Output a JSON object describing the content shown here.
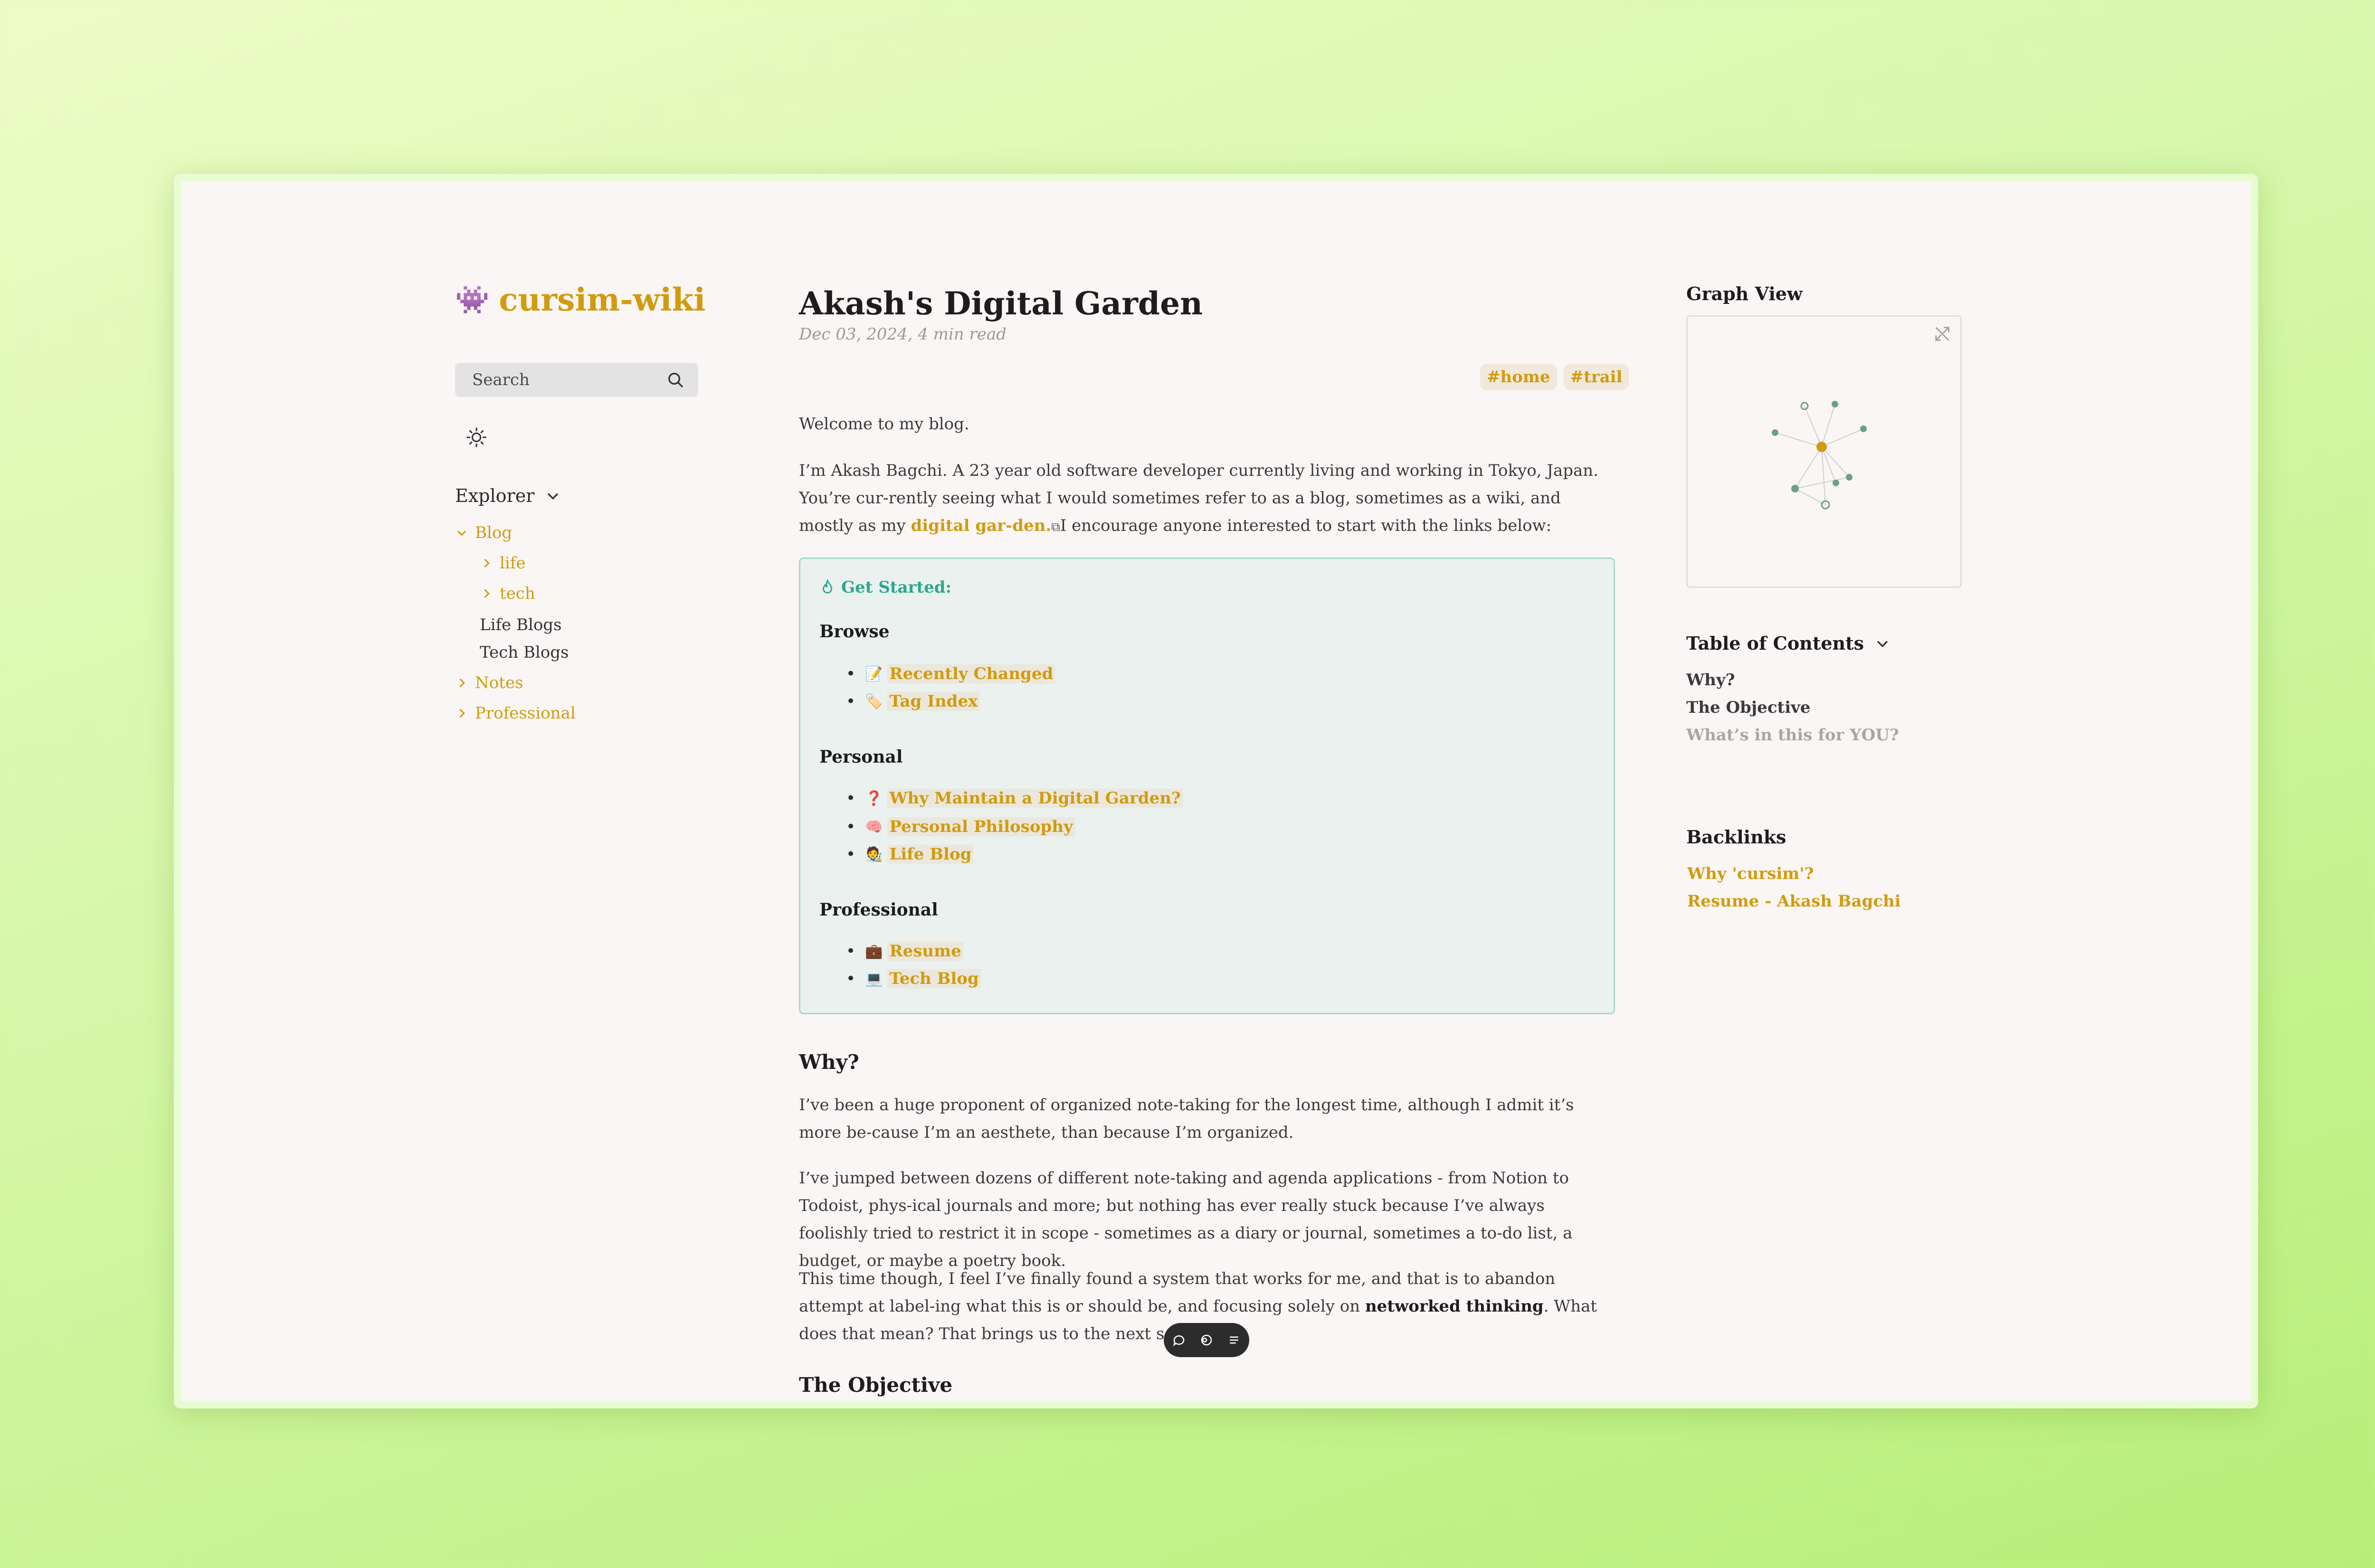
{
  "site": {
    "logo": "👾",
    "name": "cursim-wiki"
  },
  "search": {
    "label": "Search"
  },
  "explorer": {
    "title": "Explorer",
    "items": [
      {
        "label": "Blog"
      },
      {
        "label": "life"
      },
      {
        "label": "tech"
      },
      {
        "label": "Life Blogs"
      },
      {
        "label": "Tech Blogs"
      },
      {
        "label": "Notes"
      },
      {
        "label": "Professional"
      }
    ]
  },
  "article": {
    "title": "Akash's Digital Garden",
    "meta": "Dec 03, 2024,  4 min read",
    "tags": [
      "#home",
      "#trail"
    ],
    "welcome": "Welcome to my blog.",
    "intro_a": "I’m Akash Bagchi. A 23 year old software developer currently living and working in Tokyo, Japan. You’re cur-rently seeing what I would sometimes refer to as a blog, sometimes as a wiki, and mostly as my ",
    "intro_link": "digital gar-den.",
    "intro_b": "I encourage anyone interested to start with the links below:",
    "callout": {
      "title": "Get Started:",
      "sections": [
        {
          "heading": "Browse",
          "items": [
            {
              "emoji": "📝",
              "label": "Recently Changed"
            },
            {
              "emoji": "🏷️",
              "label": "Tag Index"
            }
          ]
        },
        {
          "heading": "Personal",
          "items": [
            {
              "emoji": "❓",
              "label": "Why Maintain a Digital Garden?"
            },
            {
              "emoji": "🧠",
              "label": "Personal Philosophy"
            },
            {
              "emoji": "🧑‍🎨",
              "label": "Life Blog"
            }
          ]
        },
        {
          "heading": "Professional",
          "items": [
            {
              "emoji": "💼",
              "label": "Resume"
            },
            {
              "emoji": "💻",
              "label": "Tech Blog"
            }
          ]
        }
      ]
    },
    "why_heading": "Why?",
    "why_p1": "I’ve been a huge proponent of organized note-taking for the longest time, although I admit it’s more be-cause I’m an aesthete, than because I’m organized.",
    "why_p2": "I’ve jumped between dozens of different note-taking and agenda applications - from Notion to Todoist, phys-ical journals and more; but nothing has ever really stuck because I’ve always foolishly tried to restrict it in scope - sometimes as a diary or journal, sometimes a to-do list, a budget, or maybe a poetry book.",
    "why_p3_a": "This time though, I feel I’ve finally found a system that works for me, and that is to abandon attempt at label-ing what this is or should be, and focusing solely on ",
    "why_p3_bold": "networked thinking",
    "why_p3_b": ". What does that mean? That brings us to the next section",
    "next_heading": "The Objective"
  },
  "graph": {
    "title": "Graph View"
  },
  "toc": {
    "title": "Table of Contents",
    "items": [
      "Why?",
      "The Objective",
      "What’s in this for YOU?"
    ]
  },
  "backlinks": {
    "title": "Backlinks",
    "items": [
      "Why 'cursim'?",
      "Resume - Akash Bagchi"
    ]
  },
  "colors": {
    "accent": "#d29b0e",
    "callout_accent": "#2aa88f",
    "node": "#6aa08a"
  }
}
